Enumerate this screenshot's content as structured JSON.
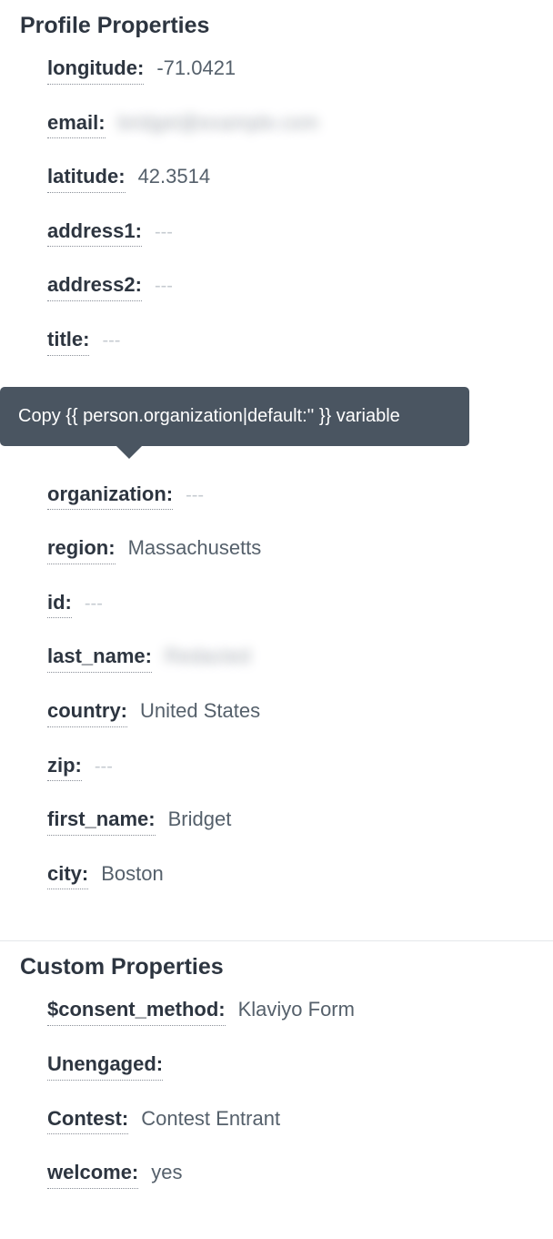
{
  "tooltip": {
    "text": "Copy {{ person.organization|default:'' }} variable"
  },
  "sections": {
    "profile": {
      "title": "Profile Properties",
      "props": {
        "longitude": {
          "label": "longitude:",
          "value": "-71.0421"
        },
        "email": {
          "label": "email:",
          "value": "bridget@example.com",
          "blurred": true
        },
        "latitude": {
          "label": "latitude:",
          "value": "42.3514"
        },
        "address1": {
          "label": "address1:",
          "value": "---",
          "empty": true
        },
        "address2": {
          "label": "address2:",
          "value": "---",
          "empty": true
        },
        "title": {
          "label": "title:",
          "value": "---",
          "empty": true
        },
        "organization": {
          "label": "organization:",
          "value": "---",
          "empty": true
        },
        "region": {
          "label": "region:",
          "value": "Massachusetts"
        },
        "id": {
          "label": "id:",
          "value": "---",
          "empty": true
        },
        "last_name": {
          "label": "last_name:",
          "value": "Redacted",
          "blurred": true
        },
        "country": {
          "label": "country:",
          "value": "United States"
        },
        "zip": {
          "label": "zip:",
          "value": "---",
          "empty": true
        },
        "first_name": {
          "label": "first_name:",
          "value": "Bridget"
        },
        "city": {
          "label": "city:",
          "value": "Boston"
        }
      }
    },
    "custom": {
      "title": "Custom Properties",
      "props": {
        "consent_method": {
          "label": "$consent_method:",
          "value": "Klaviyo Form"
        },
        "unengaged": {
          "label": "Unengaged:",
          "value": ""
        },
        "contest": {
          "label": "Contest:",
          "value": "Contest Entrant"
        },
        "welcome": {
          "label": "welcome:",
          "value": "yes"
        }
      }
    }
  }
}
